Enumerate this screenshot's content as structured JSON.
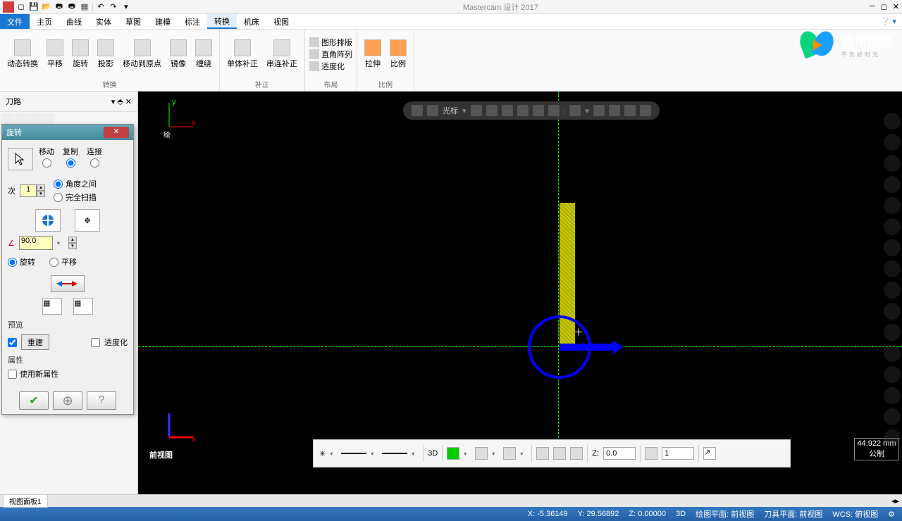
{
  "app": {
    "title": "Mastercam 设计 2017"
  },
  "menu": {
    "file": "文件",
    "tabs": [
      "主页",
      "曲线",
      "实体",
      "草图",
      "建模",
      "标注",
      "转换",
      "机床",
      "视图"
    ],
    "active": 6
  },
  "ribbon": {
    "groups": [
      {
        "label": "转换",
        "buttons": [
          "动态转换",
          "平移",
          "旋转",
          "投影",
          "移动到原点",
          "镜像",
          "缠绕"
        ]
      },
      {
        "label": "补正",
        "buttons": [
          "单体补正",
          "串连补正"
        ]
      },
      {
        "label": "布局",
        "list": [
          "图形排版",
          "直角阵列",
          "适度化"
        ]
      },
      {
        "label": "比例",
        "buttons": [
          "拉伸",
          "比例"
        ]
      }
    ]
  },
  "side_panel": {
    "title": "刀路"
  },
  "dialog": {
    "title": "旋转",
    "modes": {
      "move": "移动",
      "copy": "复制",
      "join": "连接"
    },
    "count_label": "次",
    "count_value": "1",
    "angle_between": "角度之间",
    "full_sweep": "完全扫描",
    "angle_value": "90.0",
    "rotate": "旋转",
    "translate": "平移",
    "preview": "预览",
    "rebuild": "重建",
    "optimize": "适度化",
    "attributes": "属性",
    "use_new": "使用新属性"
  },
  "viewport": {
    "view_name": "前视图",
    "axis_label": "绘",
    "scale": "44.922 mm",
    "scale_unit": "公制"
  },
  "float_toolbar": {
    "autocursor": "光标"
  },
  "bottom_bar": {
    "mode3d": "3D",
    "z_label": "Z:",
    "z_val": "0.0",
    "layer": "1"
  },
  "tabs": {
    "view_panel": "视图面板1"
  },
  "status": {
    "x": "X:",
    "xv": "-5.36149",
    "y": "Y:",
    "yv": "29.56892",
    "z": "Z:",
    "zv": "0.00000",
    "mode": "3D",
    "plane": "绘图平面: 前视图",
    "tool": "刀具平面: 前视图",
    "wcs": "WCS: 俯视图"
  },
  "tencent": {
    "main": "腾讯视频",
    "sub": "不负好时光"
  }
}
